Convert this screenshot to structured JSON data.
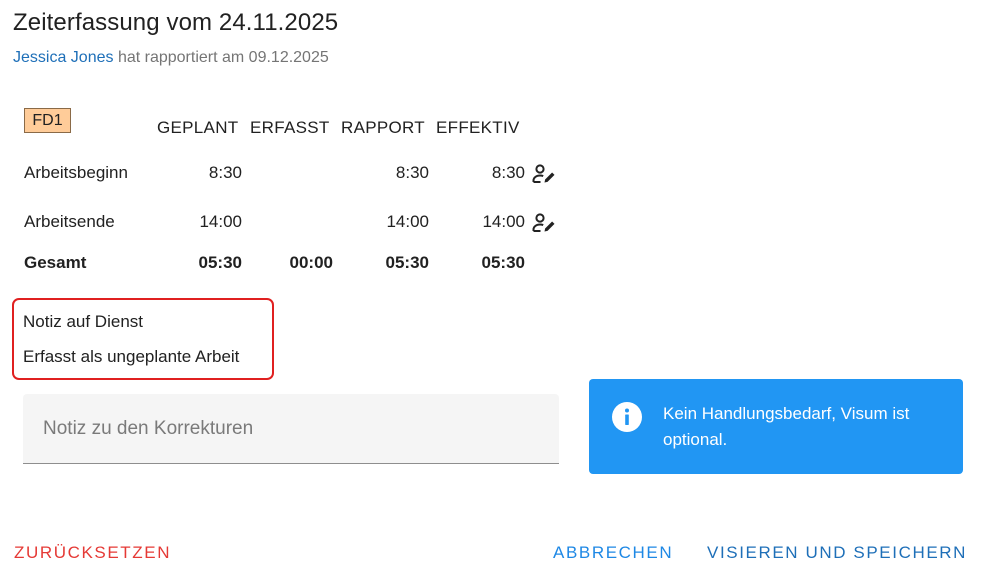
{
  "header": {
    "title": "Zeiterfassung vom 24.11.2025",
    "user_name": "Jessica Jones",
    "reported_text": " hat rapportiert am 09.12.2025"
  },
  "shift": {
    "code": "FD1",
    "color": "#ffcc99"
  },
  "table": {
    "columns": [
      "GEPLANT",
      "ERFASST",
      "RAPPORT",
      "EFFEKTIV"
    ],
    "rows": [
      {
        "label": "Arbeitsbeginn",
        "geplant": "8:30",
        "erfasst": "",
        "rapport": "8:30",
        "effektiv": "8:30",
        "icon": "edit-person-icon"
      },
      {
        "label": "Arbeitsende",
        "geplant": "14:00",
        "erfasst": "",
        "rapport": "14:00",
        "effektiv": "14:00",
        "icon": "edit-person-icon"
      }
    ],
    "total": {
      "label": "Gesamt",
      "geplant": "05:30",
      "erfasst": "00:00",
      "rapport": "05:30",
      "effektiv": "05:30"
    }
  },
  "notes": {
    "duty_note": "Notiz auf Dienst",
    "duty_detail": "Erfasst als ungeplante Arbeit",
    "highlight_color": "#e02020"
  },
  "correction_note": {
    "value": "",
    "placeholder": "Notiz zu den Korrekturen"
  },
  "info_alert": {
    "icon": "info-icon",
    "text": "Kein Handlungsbedarf, Visum ist optional.",
    "color": "#2196f3"
  },
  "actions": {
    "reset_label": "ZURÜCKSETZEN",
    "cancel_label": "ABBRECHEN",
    "save_label": "VISIEREN UND SPEICHERN",
    "reset_color": "#e53935",
    "primary_color": "#1e88e5"
  }
}
